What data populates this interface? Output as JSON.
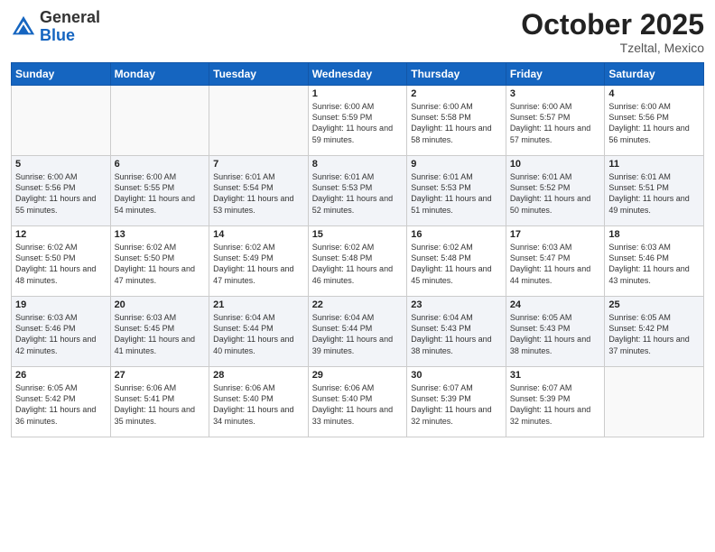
{
  "header": {
    "logo_general": "General",
    "logo_blue": "Blue",
    "month": "October 2025",
    "location": "Tzeltal, Mexico"
  },
  "weekdays": [
    "Sunday",
    "Monday",
    "Tuesday",
    "Wednesday",
    "Thursday",
    "Friday",
    "Saturday"
  ],
  "weeks": [
    [
      {
        "day": "",
        "info": ""
      },
      {
        "day": "",
        "info": ""
      },
      {
        "day": "",
        "info": ""
      },
      {
        "day": "1",
        "info": "Sunrise: 6:00 AM\nSunset: 5:59 PM\nDaylight: 11 hours and 59 minutes."
      },
      {
        "day": "2",
        "info": "Sunrise: 6:00 AM\nSunset: 5:58 PM\nDaylight: 11 hours and 58 minutes."
      },
      {
        "day": "3",
        "info": "Sunrise: 6:00 AM\nSunset: 5:57 PM\nDaylight: 11 hours and 57 minutes."
      },
      {
        "day": "4",
        "info": "Sunrise: 6:00 AM\nSunset: 5:56 PM\nDaylight: 11 hours and 56 minutes."
      }
    ],
    [
      {
        "day": "5",
        "info": "Sunrise: 6:00 AM\nSunset: 5:56 PM\nDaylight: 11 hours and 55 minutes."
      },
      {
        "day": "6",
        "info": "Sunrise: 6:00 AM\nSunset: 5:55 PM\nDaylight: 11 hours and 54 minutes."
      },
      {
        "day": "7",
        "info": "Sunrise: 6:01 AM\nSunset: 5:54 PM\nDaylight: 11 hours and 53 minutes."
      },
      {
        "day": "8",
        "info": "Sunrise: 6:01 AM\nSunset: 5:53 PM\nDaylight: 11 hours and 52 minutes."
      },
      {
        "day": "9",
        "info": "Sunrise: 6:01 AM\nSunset: 5:53 PM\nDaylight: 11 hours and 51 minutes."
      },
      {
        "day": "10",
        "info": "Sunrise: 6:01 AM\nSunset: 5:52 PM\nDaylight: 11 hours and 50 minutes."
      },
      {
        "day": "11",
        "info": "Sunrise: 6:01 AM\nSunset: 5:51 PM\nDaylight: 11 hours and 49 minutes."
      }
    ],
    [
      {
        "day": "12",
        "info": "Sunrise: 6:02 AM\nSunset: 5:50 PM\nDaylight: 11 hours and 48 minutes."
      },
      {
        "day": "13",
        "info": "Sunrise: 6:02 AM\nSunset: 5:50 PM\nDaylight: 11 hours and 47 minutes."
      },
      {
        "day": "14",
        "info": "Sunrise: 6:02 AM\nSunset: 5:49 PM\nDaylight: 11 hours and 47 minutes."
      },
      {
        "day": "15",
        "info": "Sunrise: 6:02 AM\nSunset: 5:48 PM\nDaylight: 11 hours and 46 minutes."
      },
      {
        "day": "16",
        "info": "Sunrise: 6:02 AM\nSunset: 5:48 PM\nDaylight: 11 hours and 45 minutes."
      },
      {
        "day": "17",
        "info": "Sunrise: 6:03 AM\nSunset: 5:47 PM\nDaylight: 11 hours and 44 minutes."
      },
      {
        "day": "18",
        "info": "Sunrise: 6:03 AM\nSunset: 5:46 PM\nDaylight: 11 hours and 43 minutes."
      }
    ],
    [
      {
        "day": "19",
        "info": "Sunrise: 6:03 AM\nSunset: 5:46 PM\nDaylight: 11 hours and 42 minutes."
      },
      {
        "day": "20",
        "info": "Sunrise: 6:03 AM\nSunset: 5:45 PM\nDaylight: 11 hours and 41 minutes."
      },
      {
        "day": "21",
        "info": "Sunrise: 6:04 AM\nSunset: 5:44 PM\nDaylight: 11 hours and 40 minutes."
      },
      {
        "day": "22",
        "info": "Sunrise: 6:04 AM\nSunset: 5:44 PM\nDaylight: 11 hours and 39 minutes."
      },
      {
        "day": "23",
        "info": "Sunrise: 6:04 AM\nSunset: 5:43 PM\nDaylight: 11 hours and 38 minutes."
      },
      {
        "day": "24",
        "info": "Sunrise: 6:05 AM\nSunset: 5:43 PM\nDaylight: 11 hours and 38 minutes."
      },
      {
        "day": "25",
        "info": "Sunrise: 6:05 AM\nSunset: 5:42 PM\nDaylight: 11 hours and 37 minutes."
      }
    ],
    [
      {
        "day": "26",
        "info": "Sunrise: 6:05 AM\nSunset: 5:42 PM\nDaylight: 11 hours and 36 minutes."
      },
      {
        "day": "27",
        "info": "Sunrise: 6:06 AM\nSunset: 5:41 PM\nDaylight: 11 hours and 35 minutes."
      },
      {
        "day": "28",
        "info": "Sunrise: 6:06 AM\nSunset: 5:40 PM\nDaylight: 11 hours and 34 minutes."
      },
      {
        "day": "29",
        "info": "Sunrise: 6:06 AM\nSunset: 5:40 PM\nDaylight: 11 hours and 33 minutes."
      },
      {
        "day": "30",
        "info": "Sunrise: 6:07 AM\nSunset: 5:39 PM\nDaylight: 11 hours and 32 minutes."
      },
      {
        "day": "31",
        "info": "Sunrise: 6:07 AM\nSunset: 5:39 PM\nDaylight: 11 hours and 32 minutes."
      },
      {
        "day": "",
        "info": ""
      }
    ]
  ]
}
